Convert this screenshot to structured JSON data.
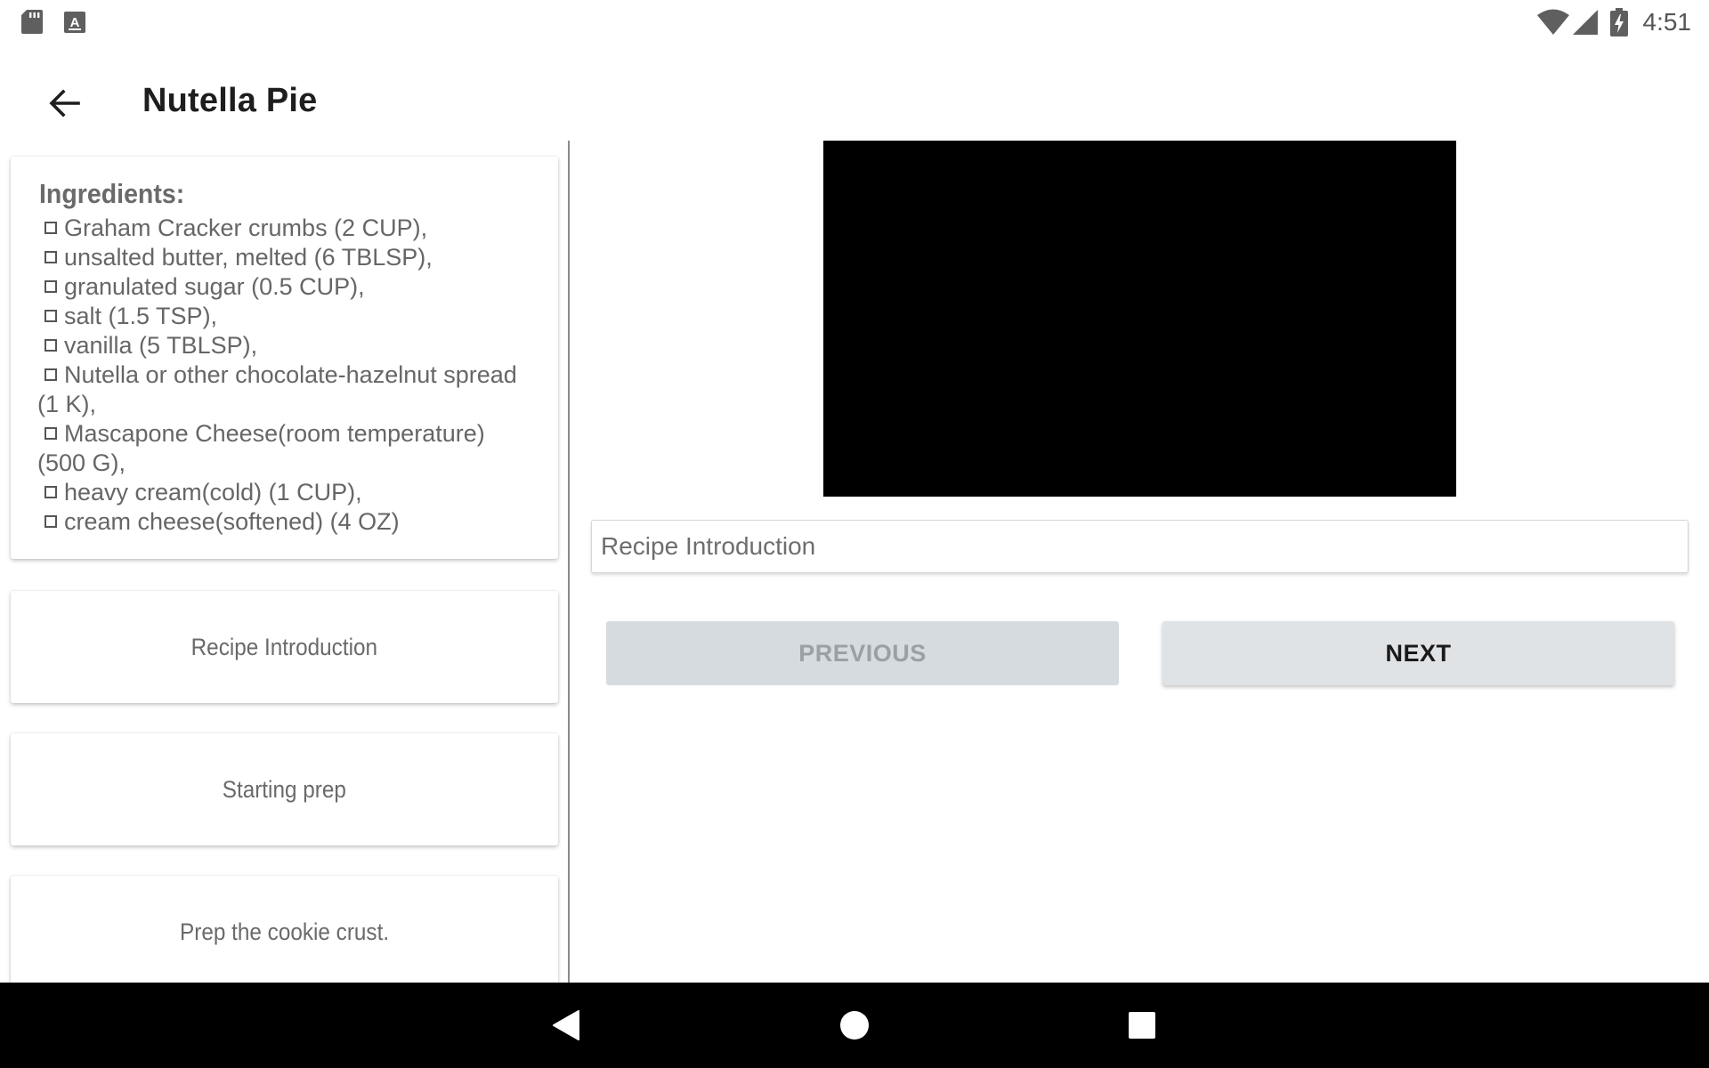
{
  "status_bar": {
    "time": "4:51",
    "icons": [
      "sd-card-icon",
      "a-keyboard-icon",
      "wifi-icon",
      "signal-icon",
      "battery-charging-icon"
    ]
  },
  "app_bar": {
    "title": "Nutella Pie",
    "back_icon": "arrow-back-icon"
  },
  "ingredients": {
    "title": "Ingredients:",
    "items": [
      "Graham Cracker crumbs (2 CUP),",
      "unsalted butter, melted (6 TBLSP),",
      "granulated sugar (0.5 CUP),",
      "salt (1.5 TSP),",
      "vanilla (5 TBLSP),",
      "Nutella or other chocolate-hazelnut spread (1 K),",
      "Mascapone Cheese(room temperature) (500 G),",
      "heavy cream(cold) (1 CUP),",
      "cream cheese(softened) (4 OZ)"
    ]
  },
  "steps": [
    {
      "label": "Recipe Introduction"
    },
    {
      "label": "Starting prep"
    },
    {
      "label": "Prep the cookie crust."
    }
  ],
  "detail": {
    "description": "Recipe Introduction",
    "previous_label": "PREVIOUS",
    "next_label": "NEXT"
  },
  "nav_bar": {
    "icons": [
      "nav-back-icon",
      "nav-home-icon",
      "nav-recents-icon"
    ]
  }
}
